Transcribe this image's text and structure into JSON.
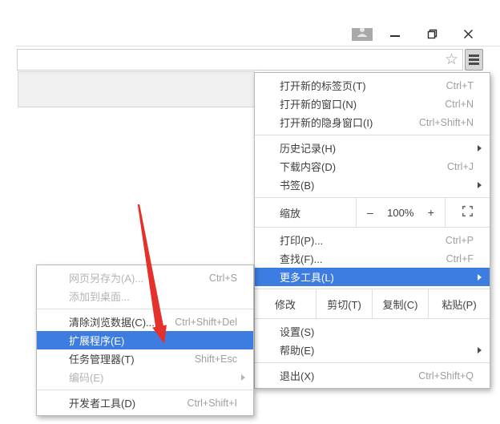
{
  "main_menu": {
    "new_tab": {
      "label": "打开新的标签页(T)",
      "shortcut": "Ctrl+T"
    },
    "new_window": {
      "label": "打开新的窗口(N)",
      "shortcut": "Ctrl+N"
    },
    "new_incognito": {
      "label": "打开新的隐身窗口(I)",
      "shortcut": "Ctrl+Shift+N"
    },
    "history": {
      "label": "历史记录(H)"
    },
    "downloads": {
      "label": "下载内容(D)",
      "shortcut": "Ctrl+J"
    },
    "bookmarks": {
      "label": "书签(B)"
    },
    "zoom": {
      "label": "缩放",
      "decrease": "–",
      "level": "100%",
      "increase": "+"
    },
    "print": {
      "label": "打印(P)...",
      "shortcut": "Ctrl+P"
    },
    "find": {
      "label": "查找(F)...",
      "shortcut": "Ctrl+F"
    },
    "more_tools": {
      "label": "更多工具(L)"
    },
    "edit": {
      "label": "修改",
      "cut": "剪切(T)",
      "copy": "复制(C)",
      "paste": "粘贴(P)"
    },
    "settings": {
      "label": "设置(S)"
    },
    "help": {
      "label": "帮助(E)"
    },
    "exit": {
      "label": "退出(X)",
      "shortcut": "Ctrl+Shift+Q"
    }
  },
  "tools_submenu": {
    "save_page": {
      "label": "网页另存为(A)...",
      "shortcut": "Ctrl+S",
      "disabled": true
    },
    "add_to_desktop": {
      "label": "添加到桌面...",
      "disabled": true
    },
    "clear_browsing_data": {
      "label": "清除浏览数据(C)...",
      "shortcut": "Ctrl+Shift+Del"
    },
    "extensions": {
      "label": "扩展程序(E)",
      "highlighted": true
    },
    "task_manager": {
      "label": "任务管理器(T)",
      "shortcut": "Shift+Esc"
    },
    "encoding": {
      "label": "编码(E)",
      "disabled": true
    },
    "developer_tools": {
      "label": "开发者工具(D)",
      "shortcut": "Ctrl+Shift+I"
    }
  },
  "toolbar": {
    "bookmark_star_glyph": "☆"
  },
  "icons": {
    "profile": "person silhouette",
    "minimize": "horizontal bar",
    "restore": "overlapping squares",
    "close": "x cross",
    "menu_button": "three horizontal bars",
    "fullscreen": "four corner brackets",
    "submenu_caret": "right-pointing triangle"
  },
  "colors": {
    "highlight_blue": "#3d7de1",
    "annotation_arrow_red": "#e4312b"
  }
}
